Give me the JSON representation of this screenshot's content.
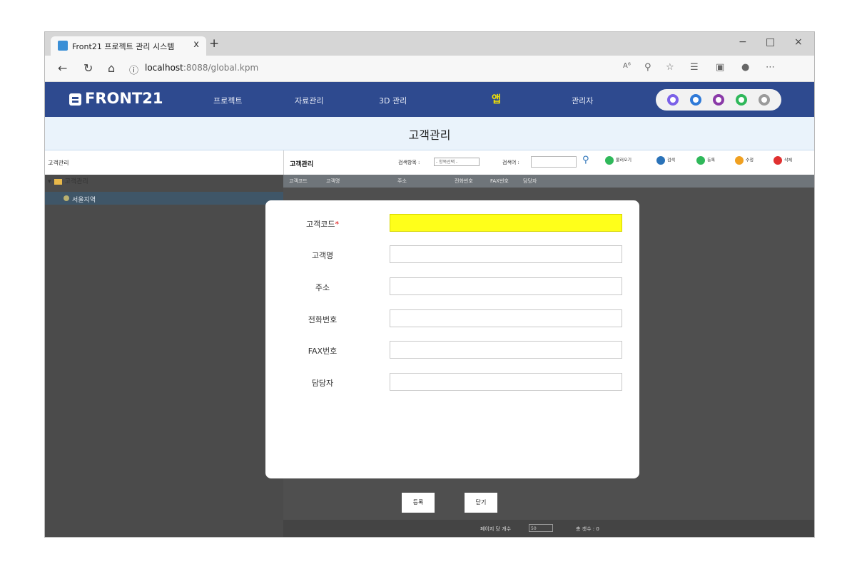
{
  "browser": {
    "tab_title": "Front21 프로젝트 관리 시스템",
    "tab_close": "x",
    "new_tab": "+",
    "url_host": "localhost",
    "url_rest": ":8088/global.kpm",
    "minimize": "−",
    "maximize": "□",
    "close": "×"
  },
  "app": {
    "logo": "FRONT21",
    "menu": [
      "프로젝트",
      "자료관리",
      "3D 관리",
      "앱",
      "관리자"
    ],
    "user_icon_colors": [
      "#7b61e8",
      "#2f7ad8",
      "#8a3aa8",
      "#2fb85a",
      "#9a9a9a"
    ]
  },
  "page_title": "고객관리",
  "left_panel": {
    "header": "고객관리",
    "tree_root": "고객관리",
    "tree_child": "서울지역"
  },
  "toolbar": {
    "title": "고객관리",
    "search_field_label": "검색항목 :",
    "search_field_select": "- 항목선택 -",
    "search_term_label": "검색어 :",
    "search_term_value": "",
    "refresh": "불러오기",
    "search": "검색",
    "register": "등록",
    "edit": "수정",
    "delete": "삭제"
  },
  "table": {
    "columns": [
      "고객코드",
      "고객명",
      "주소",
      "전화번호",
      "FAX번호",
      "담당자"
    ]
  },
  "form": {
    "fields": [
      {
        "label": "고객코드",
        "required_mark": "*",
        "value": ""
      },
      {
        "label": "고객명",
        "value": ""
      },
      {
        "label": "주소",
        "value": ""
      },
      {
        "label": "전화번호",
        "value": ""
      },
      {
        "label": "FAX번호",
        "value": ""
      },
      {
        "label": "담당자",
        "value": ""
      }
    ],
    "save_label": "등록",
    "close_label": "닫기"
  },
  "pager": {
    "page_size_label": "페이지 당 개수",
    "page_size": "50",
    "total_label": "총 갯수 : 0"
  }
}
